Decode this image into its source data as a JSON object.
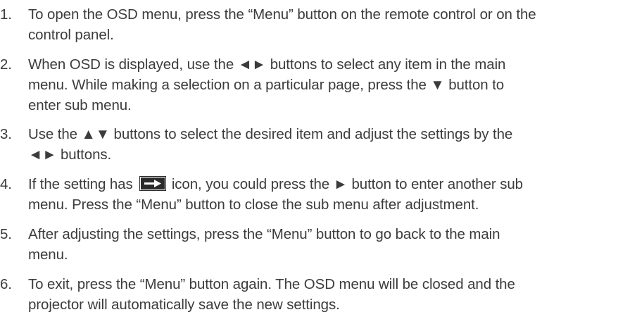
{
  "steps": [
    {
      "number": "1.",
      "lines": [
        "To open the OSD menu, press the “Menu” button on the remote control or on the",
        "control panel."
      ]
    },
    {
      "number": "2.",
      "lines": [
        "When OSD is displayed, use the ◄► buttons to select any item in the main",
        "menu. While making a selection on a particular page, press the ▼ button to",
        "enter sub menu."
      ]
    },
    {
      "number": "3.",
      "lines": [
        "Use the ▲▼ buttons to select the desired item and adjust the settings by the",
        "◄► buttons."
      ]
    },
    {
      "number": "4.",
      "line1_before_icon": "If the setting has ",
      "line1_after_icon": " icon, you could press the ► button to enter another sub",
      "line2": "menu. Press the “Menu” button to close the sub menu after adjustment.",
      "icon": "enter-submenu-icon"
    },
    {
      "number": "5.",
      "lines": [
        "After adjusting the settings, press the “Menu” button to go back to the main",
        "menu."
      ]
    },
    {
      "number": "6.",
      "lines": [
        "To exit, press the “Menu” button again. The OSD menu will be closed and the",
        "projector will automatically save the new settings."
      ]
    }
  ],
  "colors": {
    "text": "#3c3c3c",
    "icon_fill": "#2a2a2a"
  }
}
